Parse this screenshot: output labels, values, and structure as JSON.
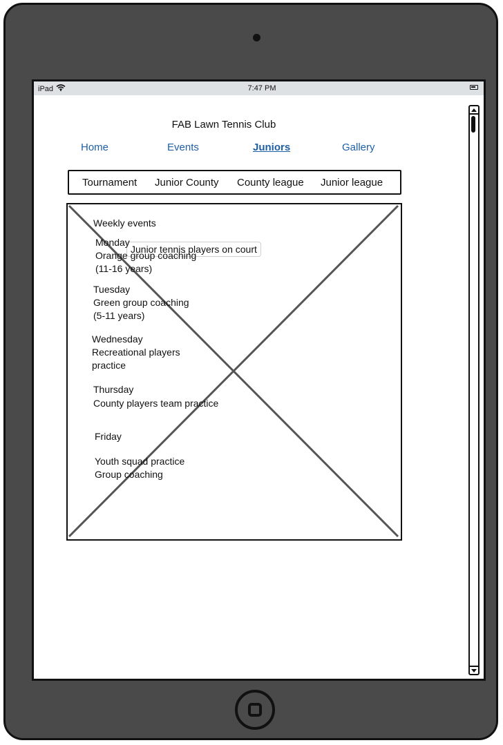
{
  "status_bar": {
    "device_label": "iPad",
    "time": "7:47 PM"
  },
  "site": {
    "title": "FAB Lawn Tennis Club"
  },
  "nav": {
    "items": [
      {
        "label": "Home"
      },
      {
        "label": "Events"
      },
      {
        "label": "Juniors",
        "active": true
      },
      {
        "label": "Gallery"
      }
    ]
  },
  "subnav": {
    "items": [
      {
        "label": "Tournament"
      },
      {
        "label": "Junior County"
      },
      {
        "label": "County league"
      },
      {
        "label": "Junior league"
      }
    ]
  },
  "image": {
    "caption": "Junior tennis players on court"
  },
  "weekly": {
    "heading": "Weekly events",
    "monday": {
      "day": "Monday",
      "line1": "Orange group coaching",
      "line2": "(11-16 years)"
    },
    "tuesday": {
      "day": "Tuesday",
      "line1": "Green group coaching",
      "line2": "(5-11 years)"
    },
    "wednesday": {
      "day": "Wednesday",
      "line1": "Recreational players",
      "line2": "practice"
    },
    "thursday": {
      "day": "Thursday",
      "line1": "County players team practice"
    },
    "friday": {
      "day": "Friday",
      "line1": "Youth squad practice",
      "line2": "Group coaching"
    }
  },
  "icons": {
    "wifi": "wifi-icon",
    "battery": "battery-icon",
    "camera": "camera-icon",
    "home": "home-button-icon"
  },
  "colors": {
    "device_body": "#4a4a4a",
    "link": "#1f5fa6",
    "status_bar": "#dde1e4"
  }
}
